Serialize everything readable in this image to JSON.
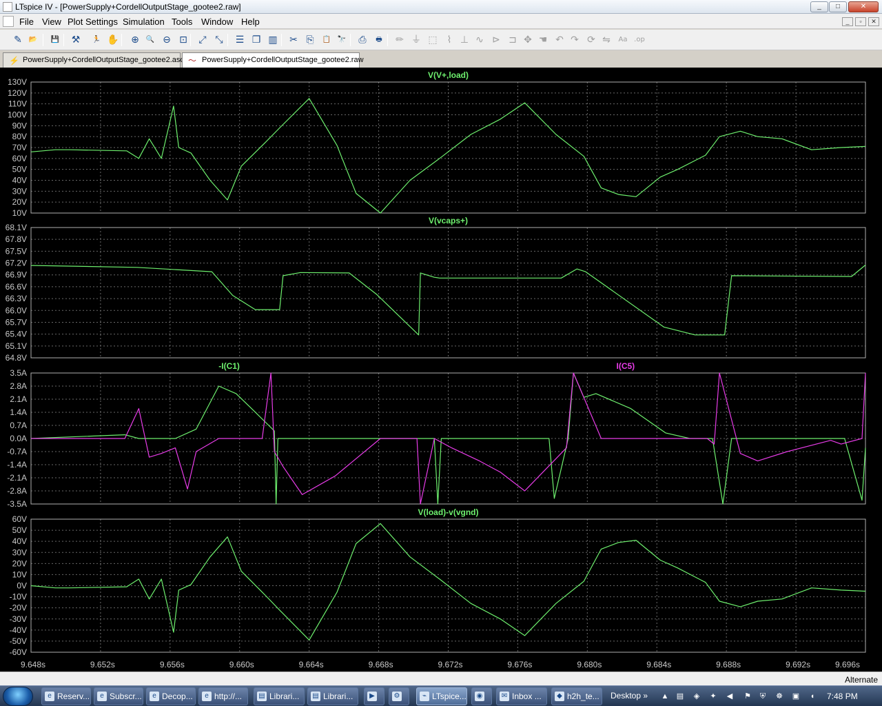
{
  "window": {
    "title": "LTspice IV - [PowerSupply+CordellOutputStage_gootee2.raw]",
    "buttons": {
      "minimize": "_",
      "maximize": "□",
      "close": "✕"
    }
  },
  "menu": {
    "items": [
      "File",
      "View",
      "Plot Settings",
      "Simulation",
      "Tools",
      "Window",
      "Help"
    ],
    "mdi_buttons": [
      "_",
      "▫",
      "✕"
    ]
  },
  "toolbar": {
    "icons": [
      {
        "name": "new-schematic-icon",
        "glyph": "✎",
        "enabled": true
      },
      {
        "name": "open-icon",
        "glyph": "📂",
        "enabled": true
      },
      {
        "name": "save-icon",
        "glyph": "💾",
        "enabled": true
      },
      {
        "name": "control-panel-icon",
        "glyph": "⚒",
        "enabled": true
      },
      {
        "name": "run-icon",
        "glyph": "🏃",
        "enabled": true
      },
      {
        "name": "halt-icon",
        "glyph": "✋",
        "enabled": true
      },
      {
        "name": "zoom-in-icon",
        "glyph": "⊕",
        "enabled": true
      },
      {
        "name": "zoom-area-icon",
        "glyph": "🔍",
        "enabled": true
      },
      {
        "name": "zoom-out-icon",
        "glyph": "⊖",
        "enabled": true
      },
      {
        "name": "zoom-fit-icon",
        "glyph": "⊡",
        "enabled": true
      },
      {
        "name": "autoscale-icon",
        "glyph": "⤢",
        "enabled": true
      },
      {
        "name": "autorange-icon",
        "glyph": "⤡",
        "enabled": true
      },
      {
        "name": "tile-horizontal-icon",
        "glyph": "☰",
        "enabled": true
      },
      {
        "name": "cascade-icon",
        "glyph": "❐",
        "enabled": true
      },
      {
        "name": "tile-vertical-icon",
        "glyph": "▥",
        "enabled": true
      },
      {
        "name": "cut-icon",
        "glyph": "✂",
        "enabled": true
      },
      {
        "name": "copy-icon",
        "glyph": "⎘",
        "enabled": true
      },
      {
        "name": "paste-icon",
        "glyph": "📋",
        "enabled": true
      },
      {
        "name": "find-icon",
        "glyph": "🔭",
        "enabled": true
      },
      {
        "name": "print-setup-icon",
        "glyph": "⎙",
        "enabled": true
      },
      {
        "name": "print-icon",
        "glyph": "🖶",
        "enabled": true
      },
      {
        "name": "wire-icon",
        "glyph": "✏",
        "enabled": false
      },
      {
        "name": "ground-icon",
        "glyph": "⏚",
        "enabled": false
      },
      {
        "name": "label-net-icon",
        "glyph": "⬚",
        "enabled": false
      },
      {
        "name": "resistor-icon",
        "glyph": "⌇",
        "enabled": false
      },
      {
        "name": "capacitor-icon",
        "glyph": "⊥",
        "enabled": false
      },
      {
        "name": "inductor-icon",
        "glyph": "∿",
        "enabled": false
      },
      {
        "name": "diode-icon",
        "glyph": "⊳",
        "enabled": false
      },
      {
        "name": "component-icon",
        "glyph": "⊐",
        "enabled": false
      },
      {
        "name": "move-icon",
        "glyph": "✥",
        "enabled": false
      },
      {
        "name": "drag-icon",
        "glyph": "☚",
        "enabled": false
      },
      {
        "name": "undo-icon",
        "glyph": "↶",
        "enabled": false
      },
      {
        "name": "redo-icon",
        "glyph": "↷",
        "enabled": false
      },
      {
        "name": "rotate-icon",
        "glyph": "⟳",
        "enabled": false
      },
      {
        "name": "mirror-icon",
        "glyph": "⇋",
        "enabled": false
      },
      {
        "name": "text-icon",
        "glyph": "Aa",
        "enabled": false
      },
      {
        "name": "spice-directive-icon",
        "glyph": ".op",
        "enabled": false
      }
    ]
  },
  "tabs": [
    {
      "label": "PowerSupply+CordellOutputStage_gootee2.asc",
      "icon": "schematic-icon",
      "active": false
    },
    {
      "label": "PowerSupply+CordellOutputStage_gootee2.raw",
      "icon": "waveform-icon",
      "active": true
    }
  ],
  "colors": {
    "trace_green": "#6ef06e",
    "trace_magenta": "#e83ce8",
    "grid": "#6a6a6a",
    "plot_background": "#000000",
    "frame": "#b0b0b0",
    "axis_text": "#c8c8c8"
  },
  "chart_data": [
    {
      "type": "line",
      "title": "V(V+,load)",
      "ylim": [
        10,
        130
      ],
      "yticks": [
        "130V",
        "120V",
        "110V",
        "100V",
        "90V",
        "80V",
        "70V",
        "60V",
        "50V",
        "40V",
        "30V",
        "20V",
        "10V"
      ],
      "grid": true,
      "series": [
        {
          "name": "V(V+,load)",
          "color": "#6ef06e",
          "x": [
            9.648,
            9.6494,
            9.6502,
            9.6535,
            9.6542,
            9.6548,
            9.6555,
            9.6562,
            9.6565,
            9.6572,
            9.6583,
            9.6593,
            9.6601,
            9.6615,
            9.6623,
            9.664,
            9.6656,
            9.6667,
            9.6681,
            9.6698,
            9.6715,
            9.6733,
            9.675,
            9.6764,
            9.6782,
            9.6798,
            9.6808,
            9.6818,
            9.6828,
            9.6842,
            9.6852,
            9.6868,
            9.6876,
            9.6888,
            9.6898,
            9.6912,
            9.6929,
            9.6946,
            9.696
          ],
          "y": [
            66,
            68,
            68,
            67,
            60,
            78,
            60,
            108,
            70,
            65,
            40,
            22,
            53,
            75,
            88,
            115,
            72,
            28,
            10,
            40,
            60,
            82,
            96,
            111,
            82,
            62,
            33,
            27,
            25,
            43,
            50,
            63,
            80,
            85,
            80,
            78,
            68,
            70,
            71
          ]
        }
      ]
    },
    {
      "type": "line",
      "title": "V(vcaps+)",
      "ylim": [
        64.8,
        68.1
      ],
      "yticks": [
        "68.1V",
        "67.8V",
        "67.5V",
        "67.2V",
        "66.9V",
        "66.6V",
        "66.3V",
        "66.0V",
        "65.7V",
        "65.4V",
        "65.1V",
        "64.8V"
      ],
      "grid": true,
      "series": [
        {
          "name": "V(vcaps+)",
          "color": "#6ef06e",
          "x": [
            9.648,
            9.6541,
            9.6584,
            9.6596,
            9.6609,
            9.6623,
            9.6625,
            9.6635,
            9.6663,
            9.6679,
            9.6703,
            9.6704,
            9.6712,
            9.6715,
            9.6784,
            9.6785,
            9.6794,
            9.6799,
            9.6844,
            9.6862,
            9.6866,
            9.6879,
            9.6883,
            9.6952,
            9.696
          ],
          "y": [
            67.14,
            67.09,
            66.98,
            66.38,
            66.02,
            66.02,
            66.88,
            66.96,
            66.95,
            66.4,
            65.38,
            66.95,
            66.84,
            66.82,
            66.82,
            66.82,
            67.05,
            66.98,
            65.58,
            65.38,
            65.38,
            65.38,
            66.88,
            66.86,
            67.15
          ]
        }
      ]
    },
    {
      "type": "line",
      "title": "-I(C1)",
      "title2": "I(C5)",
      "ylim": [
        -3.5,
        3.5
      ],
      "yticks": [
        "3.5A",
        "2.8A",
        "2.1A",
        "1.4A",
        "0.7A",
        "0.0A",
        "-0.7A",
        "-1.4A",
        "-2.1A",
        "-2.8A",
        "-3.5A"
      ],
      "grid": true,
      "series": [
        {
          "name": "-I(C1)",
          "color": "#6ef06e",
          "x": [
            9.648,
            9.6534,
            9.6542,
            9.6553,
            9.6563,
            9.6575,
            9.6588,
            9.6598,
            9.6608,
            9.662,
            9.6621,
            9.6622,
            9.663,
            9.6645,
            9.6658,
            9.6668,
            9.6698,
            9.6712,
            9.6714,
            9.6716,
            9.6723,
            9.6738,
            9.6753,
            9.6763,
            9.6772,
            9.6778,
            9.6781,
            9.6789,
            9.6792,
            9.6798,
            9.6805,
            9.6825,
            9.6845,
            9.6859,
            9.6872,
            9.6878,
            9.6883,
            9.6891,
            9.6904,
            9.6948,
            9.6958,
            9.696
          ],
          "y": [
            0,
            0.2,
            0,
            0,
            0,
            0.5,
            2.8,
            2.4,
            1.5,
            0.4,
            -3.5,
            0,
            0,
            0,
            0,
            0,
            0,
            0,
            -3.5,
            0,
            0,
            0,
            0,
            0,
            0,
            0,
            -3.2,
            0,
            3.5,
            2.2,
            2.4,
            1.6,
            0.3,
            0,
            0,
            -3.5,
            0,
            0,
            0,
            0,
            -3.3,
            -0.5
          ]
        },
        {
          "name": "I(C5)",
          "color": "#e83ce8",
          "x": [
            9.648,
            9.6534,
            9.6542,
            9.6548,
            9.6555,
            9.6563,
            9.657,
            9.6575,
            9.6588,
            9.6605,
            9.6613,
            9.6618,
            9.662,
            9.6625,
            9.6636,
            9.6655,
            9.6681,
            9.6702,
            9.6704,
            9.6712,
            9.6722,
            9.6738,
            9.675,
            9.6764,
            9.6788,
            9.6792,
            9.6808,
            9.6828,
            9.6855,
            9.6869,
            9.6873,
            9.6876,
            9.6888,
            9.6898,
            9.6915,
            9.694,
            9.6946,
            9.6958,
            9.696
          ],
          "y": [
            0,
            0,
            1.6,
            -1.0,
            -0.8,
            -0.5,
            -2.7,
            -0.7,
            0,
            0,
            0,
            3.5,
            -0.7,
            -1.5,
            -3.0,
            -2.0,
            0,
            0,
            -3.5,
            0,
            -0.5,
            -1.2,
            -1.8,
            -2.8,
            -0.5,
            3.5,
            0,
            0,
            0,
            0,
            -0.3,
            3.5,
            -0.8,
            -1.2,
            -0.7,
            -0.1,
            -0.3,
            0,
            3.5
          ]
        }
      ]
    },
    {
      "type": "line",
      "title": "V(load)-v(vgnd)",
      "ylim": [
        -60,
        60
      ],
      "yticks": [
        "60V",
        "50V",
        "40V",
        "30V",
        "20V",
        "10V",
        "0V",
        "-10V",
        "-20V",
        "-30V",
        "-40V",
        "-50V",
        "-60V"
      ],
      "grid": true,
      "series": [
        {
          "name": "V(load)-v(vgnd)",
          "color": "#6ef06e",
          "x": [
            9.648,
            9.6494,
            9.6502,
            9.6535,
            9.6542,
            9.6548,
            9.6555,
            9.6562,
            9.6565,
            9.6572,
            9.6583,
            9.6593,
            9.6601,
            9.6615,
            9.6623,
            9.664,
            9.6656,
            9.6667,
            9.6681,
            9.6698,
            9.6715,
            9.6733,
            9.675,
            9.6764,
            9.6782,
            9.6798,
            9.6808,
            9.6818,
            9.6828,
            9.6842,
            9.6852,
            9.6868,
            9.6876,
            9.6888,
            9.6898,
            9.6912,
            9.6929,
            9.6946,
            9.696
          ],
          "y": [
            0,
            -2,
            -2,
            -1,
            6,
            -12,
            6,
            -42,
            -4,
            1,
            26,
            44,
            13,
            -9,
            -22,
            -49,
            -6,
            38,
            56,
            26,
            6,
            -16,
            -30,
            -45,
            -16,
            4,
            33,
            39,
            41,
            23,
            16,
            3,
            -14,
            -19,
            -14,
            -12,
            -2,
            -4,
            -5
          ]
        }
      ]
    }
  ],
  "x_axis": {
    "ticks": [
      "9.648s",
      "9.652s",
      "9.656s",
      "9.660s",
      "9.664s",
      "9.668s",
      "9.672s",
      "9.676s",
      "9.680s",
      "9.684s",
      "9.688s",
      "9.692s",
      "9.696s"
    ],
    "xlim": [
      9.648,
      9.696
    ]
  },
  "status": {
    "text": "Alternate"
  },
  "taskbar": {
    "tasks": [
      {
        "label": "Reserv...",
        "icon": "ie-icon"
      },
      {
        "label": "Subscr...",
        "icon": "ie-icon"
      },
      {
        "label": "Decop...",
        "icon": "ie-icon"
      },
      {
        "label": "http://...",
        "icon": "ie-icon"
      },
      {
        "label": "Librari...",
        "icon": "folder-icon"
      },
      {
        "label": "Librari...",
        "icon": "folder-icon"
      },
      {
        "label": "",
        "icon": "media-icon"
      },
      {
        "label": "",
        "icon": "tool-icon"
      },
      {
        "label": "LTspice...",
        "icon": "ltspice-icon",
        "active": true
      },
      {
        "label": "",
        "icon": "chrome-icon"
      },
      {
        "label": "Inbox ...",
        "icon": "mail-icon"
      },
      {
        "label": "h2h_te...",
        "icon": "app-icon"
      }
    ],
    "desktop": "Desktop",
    "desktop_chevron": "»",
    "time": "7:48 PM"
  }
}
